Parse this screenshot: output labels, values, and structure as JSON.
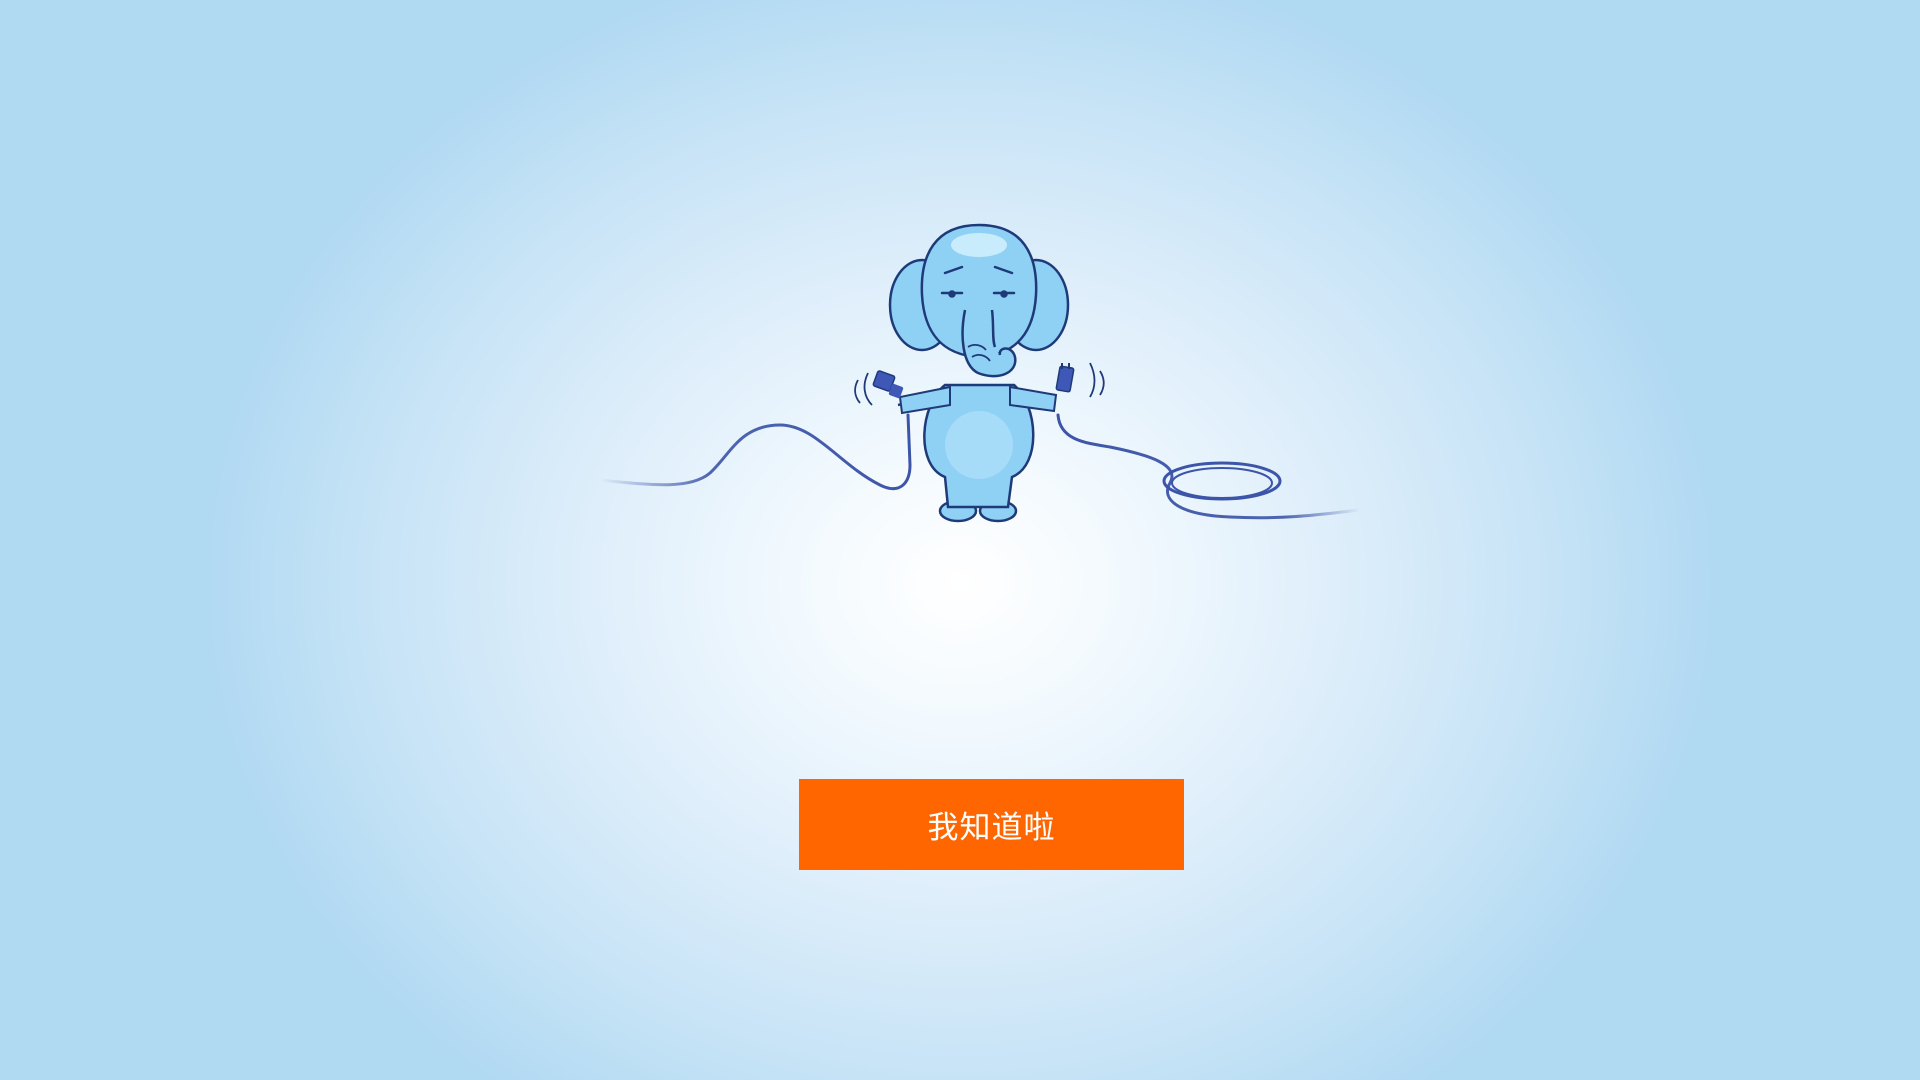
{
  "illustration": {
    "subject": "elephant-holding-unplugged-network-cable",
    "colors": {
      "body": "#8fd0f5",
      "body_light": "#bfe6fb",
      "outline": "#1f3a78",
      "cable": "#3d55a8",
      "plug": "#3f58b8"
    }
  },
  "actions": {
    "ack_label": "我知道啦"
  },
  "colors": {
    "button_bg": "#ff6600",
    "button_text": "#ffffff",
    "bg_center": "#ffffff",
    "bg_edge": "#b0d9f2"
  }
}
